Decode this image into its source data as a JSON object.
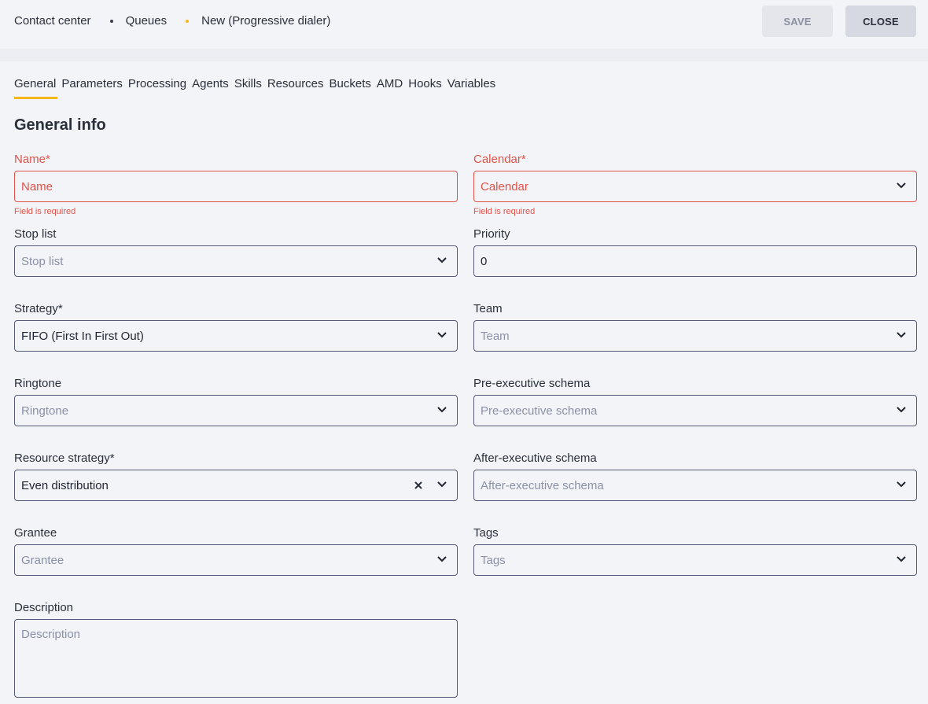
{
  "breadcrumb": {
    "item1": "Contact center",
    "item2": "Queues",
    "item3": "New (Progressive dialer)"
  },
  "actions": {
    "save": "SAVE",
    "close": "CLOSE"
  },
  "tabs": [
    "General",
    "Parameters",
    "Processing",
    "Agents",
    "Skills",
    "Resources",
    "Buckets",
    "AMD",
    "Hooks",
    "Variables"
  ],
  "section_title": "General info",
  "required_hint": "Field is required",
  "fields": {
    "name": {
      "label": "Name*",
      "placeholder": "Name"
    },
    "calendar": {
      "label": "Calendar*",
      "placeholder": "Calendar"
    },
    "stop_list": {
      "label": "Stop list",
      "placeholder": "Stop list"
    },
    "priority": {
      "label": "Priority",
      "value": "0"
    },
    "strategy": {
      "label": "Strategy*",
      "value": "FIFO (First In First Out)"
    },
    "team": {
      "label": "Team",
      "placeholder": "Team"
    },
    "ringtone": {
      "label": "Ringtone",
      "placeholder": "Ringtone"
    },
    "pre_schema": {
      "label": "Pre-executive schema",
      "placeholder": "Pre-executive schema"
    },
    "resource_strategy": {
      "label": "Resource strategy*",
      "value": "Even distribution"
    },
    "after_schema": {
      "label": "After-executive schema",
      "placeholder": "After-executive schema"
    },
    "grantee": {
      "label": "Grantee",
      "placeholder": "Grantee"
    },
    "tags": {
      "label": "Tags",
      "placeholder": "Tags"
    },
    "description": {
      "label": "Description",
      "placeholder": "Description"
    }
  },
  "colors": {
    "accent": "#f5b619",
    "error": "#e0534a",
    "border": "#545a78",
    "background": "#f3f4f8"
  }
}
